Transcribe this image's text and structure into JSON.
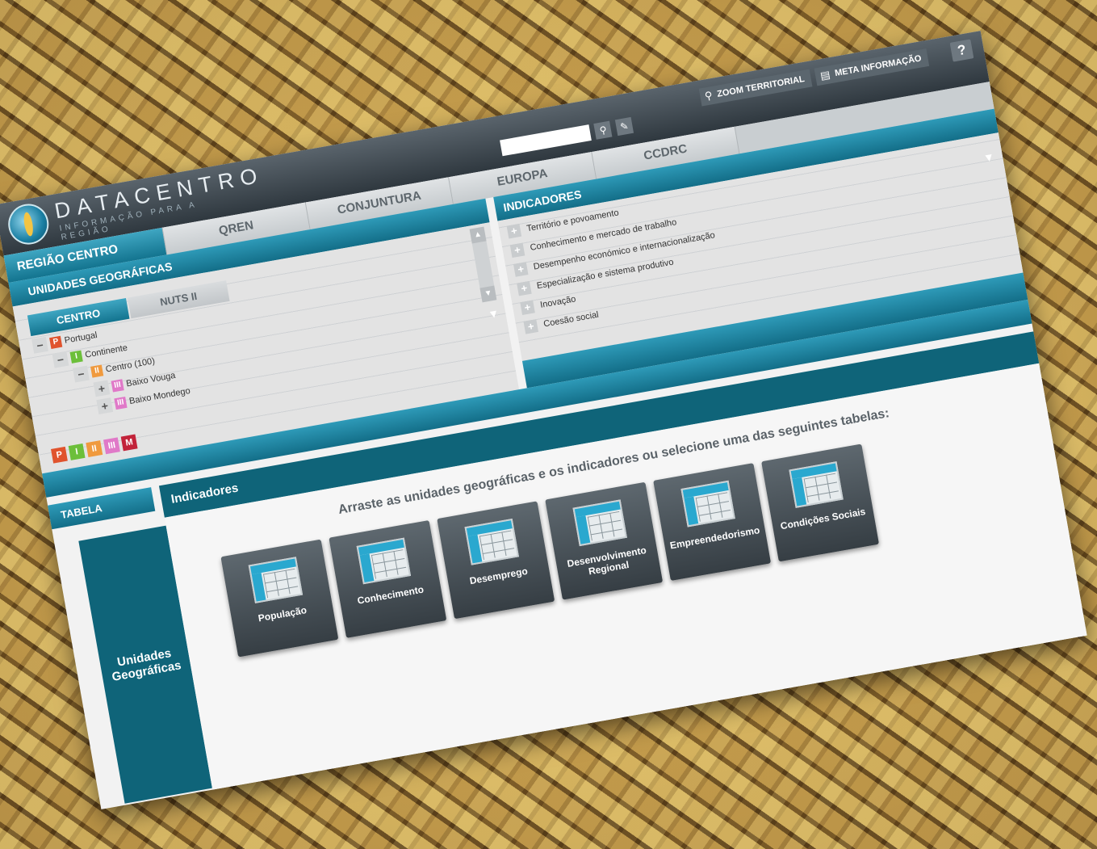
{
  "header": {
    "brand": "DATACENTRO",
    "tagline": "INFORMAÇÃO PARA A REGIÃO",
    "help": "?",
    "actions": {
      "zoom": "ZOOM TERRITORIAL",
      "meta": "META INFORMAÇÃO"
    },
    "search": {
      "value": "",
      "placeholder": ""
    }
  },
  "nav": {
    "tabs": [
      "REGIÃO CENTRO",
      "QREN",
      "CONJUNTURA",
      "EUROPA",
      "CCDRC"
    ]
  },
  "left_panel": {
    "title": "UNIDADES GEOGRÁFICAS",
    "subtabs": [
      "CENTRO",
      "NUTS II"
    ],
    "tree": [
      {
        "toggle": "−",
        "level": "P",
        "label": "Portugal"
      },
      {
        "toggle": "−",
        "level": "I",
        "label": "Continente"
      },
      {
        "toggle": "−",
        "level": "II",
        "label": "Centro (100)"
      },
      {
        "toggle": "+",
        "level": "III",
        "label": "Baixo Vouga"
      },
      {
        "toggle": "+",
        "level": "III",
        "label": "Baixo Mondego"
      }
    ],
    "legend": [
      "P",
      "I",
      "II",
      "III",
      "M"
    ]
  },
  "right_panel": {
    "title": "INDICADORES",
    "items": [
      "Território e povoamento",
      "Conhecimento e mercado de trabalho",
      "Desempenho económico e internacionalização",
      "Especialização e sistema produtivo",
      "Inovação",
      "Coesão social"
    ]
  },
  "table_section": {
    "title": "TABELA",
    "indicators_label": "Indicadores",
    "geo_label": "Unidades Geográficas",
    "instruction": "Arraste as unidades geográficas e os indicadores ou selecione uma das seguintes tabelas:",
    "cards": [
      "População",
      "Conhecimento",
      "Desemprego",
      "Desenvolvimento Regional",
      "Empreendedorismo",
      "Condições Sociais"
    ]
  },
  "colors": {
    "accent_teal": "#13748f",
    "dark_teal": "#0f6479",
    "header_dark": "#2f383f",
    "level_P": "#e0532d",
    "level_I": "#6cbf3a",
    "level_II": "#f09a3e",
    "level_III": "#e079c8",
    "level_M": "#c2233a"
  },
  "icons": [
    "search-icon",
    "eraser-icon",
    "magnifier-icon",
    "meta-info-icon",
    "help-icon",
    "table-icon"
  ]
}
